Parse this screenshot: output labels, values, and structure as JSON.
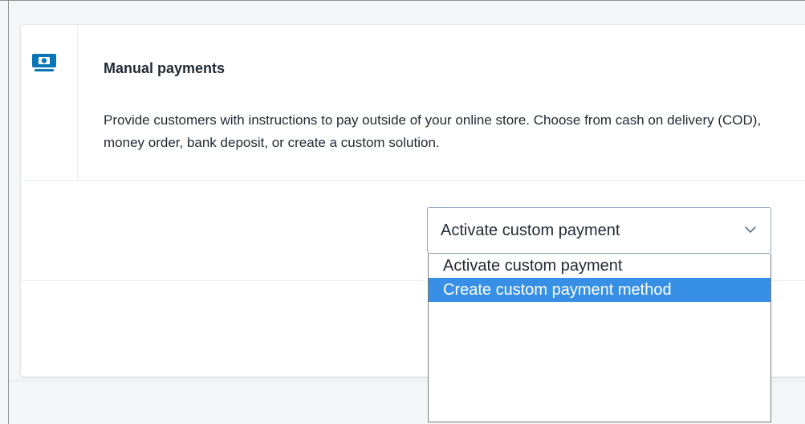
{
  "card": {
    "icon": "money-icon",
    "title": "Manual payments",
    "description": "Provide customers with instructions to pay outside of your online store. Choose from cash on delivery (COD), money order, bank deposit, or create a custom solution."
  },
  "select": {
    "value": "Activate custom payment",
    "icon": "chevron-down-icon",
    "options": [
      {
        "label": "Activate custom payment"
      },
      {
        "label": "Create custom payment method"
      }
    ],
    "highlighted_option": "Create custom payment method"
  },
  "colors": {
    "accent": "#3790e6",
    "icon": "#0a76b6",
    "text": "#212b36"
  }
}
